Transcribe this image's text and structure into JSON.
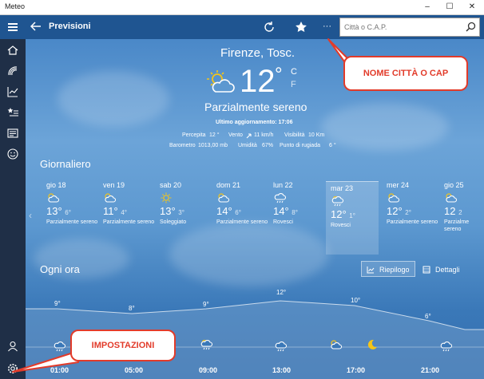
{
  "window": {
    "title": "Meteo",
    "minimize": "–",
    "maximize": "☐",
    "close": "✕"
  },
  "appbar": {
    "title": "Previsioni",
    "more": "···"
  },
  "search": {
    "placeholder": "Città o C.A.P."
  },
  "current": {
    "location": "Firenze, Tosc.",
    "temp": "12",
    "degree": "°",
    "unit_c": "C",
    "unit_f": "F",
    "condition": "Parzialmente sereno",
    "updated": "Ultimo aggiornamento: 17:06",
    "row1": [
      {
        "label": "Percepita",
        "value": "12 °"
      },
      {
        "label": "Vento",
        "value": "11 km/h"
      },
      {
        "label": "Visibilità",
        "value": "10 Km"
      }
    ],
    "row2": [
      {
        "label": "Barometro",
        "value": "1013,00 mb"
      },
      {
        "label": "Umidità",
        "value": "67%"
      },
      {
        "label": "Punto di rugiada",
        "value": "6 °"
      }
    ]
  },
  "daily": {
    "title": "Giornaliero",
    "days": [
      {
        "day": "gio 18",
        "hi": "13°",
        "lo": "6°",
        "cond": "Parzialmente sereno",
        "icon": "partly-cloudy-icon"
      },
      {
        "day": "ven 19",
        "hi": "11°",
        "lo": "4°",
        "cond": "Parzialmente sereno",
        "icon": "partly-cloudy-icon"
      },
      {
        "day": "sab 20",
        "hi": "13°",
        "lo": "3°",
        "cond": "Soleggiato",
        "icon": "sun-icon"
      },
      {
        "day": "dom 21",
        "hi": "14°",
        "lo": "6°",
        "cond": "Parzialmente sereno",
        "icon": "partly-cloudy-icon"
      },
      {
        "day": "lun 22",
        "hi": "14°",
        "lo": "8°",
        "cond": "Rovesci",
        "icon": "rain-icon"
      },
      {
        "day": "mar 23",
        "hi": "12°",
        "lo": "1°",
        "cond": "Rovesci",
        "icon": "rain-icon"
      },
      {
        "day": "mer 24",
        "hi": "12°",
        "lo": "2°",
        "cond": "Parzialmente sereno",
        "icon": "partly-cloudy-icon"
      },
      {
        "day": "gio 25",
        "hi": "12",
        "lo": "2",
        "cond": "Parzialme sereno",
        "icon": "partly-cloudy-icon"
      }
    ]
  },
  "hourly": {
    "title": "Ogni ora",
    "summary_btn": "Riepilogo",
    "details_btn": "Dettagli",
    "temps": [
      "9°",
      "8°",
      "9°",
      "12°",
      "10°",
      "6°"
    ],
    "times": [
      "01:00",
      "05:00",
      "09:00",
      "13:00",
      "17:00",
      "21:00"
    ]
  },
  "callouts": {
    "city": "NOME CITTÀ O CAP",
    "settings": "IMPOSTAZIONI"
  },
  "colors": {
    "appbar": "#1f5591",
    "sidebar": "#1f2f47",
    "callout": "#e23b2a",
    "sun": "#f5c518"
  }
}
